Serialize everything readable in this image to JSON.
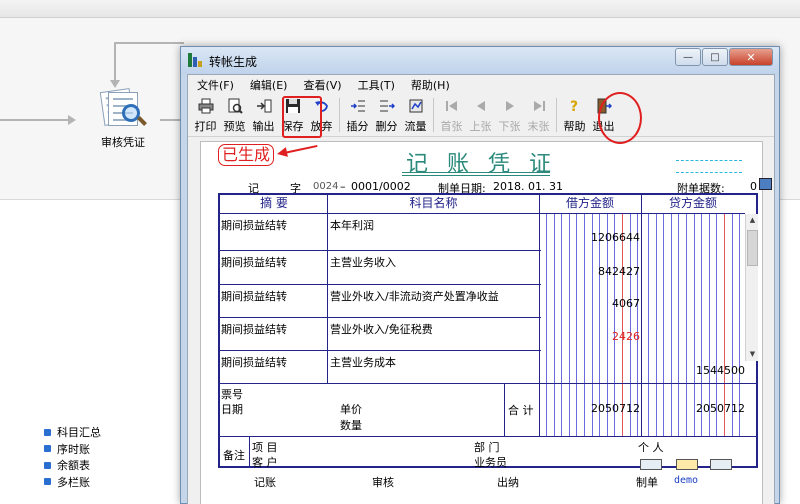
{
  "background": {
    "node_label": "审核凭证",
    "links": [
      "科目汇总",
      "序时账",
      "余额表",
      "多栏账"
    ]
  },
  "window": {
    "title": "转帐生成",
    "close_glyph": "✕",
    "min_glyph": "—",
    "max_glyph": "□"
  },
  "menu": [
    "文件(F)",
    "编辑(E)",
    "查看(V)",
    "工具(T)",
    "帮助(H)"
  ],
  "toolbar": {
    "print": "打印",
    "preview": "预览",
    "export": "输出",
    "save": "保存",
    "discard": "放弃",
    "insert_entry": "插分",
    "delete_entry": "删分",
    "cash_flow": "流量",
    "first": "首张",
    "prev": "上张",
    "next": "下张",
    "last": "末张",
    "help": "帮助",
    "exit": "退出"
  },
  "voucher": {
    "status": "已生成",
    "title": "记 账 凭 证",
    "type_label": "记",
    "number_char": "字",
    "number_code": "0024",
    "number_sep": "–",
    "number": "0001/0002",
    "date_label": "制单日期:",
    "date": "2018. 01. 31",
    "attach_label": "附单据数:",
    "attach_count": "0",
    "headers": {
      "summary": "摘  要",
      "account": "科目名称",
      "debit": "借方金额",
      "credit": "贷方金额"
    },
    "rows": [
      {
        "summary": "期间损益结转",
        "account": "本年利润",
        "debit": "1206644",
        "credit": ""
      },
      {
        "summary": "期间损益结转",
        "account": "主营业务收入",
        "debit": "842427",
        "credit": ""
      },
      {
        "summary": "期间损益结转",
        "account": "营业外收入/非流动资产处置净收益",
        "debit": "4067",
        "credit": ""
      },
      {
        "summary": "期间损益结转",
        "account": "营业外收入/免征税费",
        "debit": "2426",
        "credit": ""
      },
      {
        "summary": "期间损益结转",
        "account": "主营业务成本",
        "debit": "",
        "credit": "1544500"
      }
    ],
    "negative_row_color": "#e02020",
    "info": {
      "ticket_no": "票号",
      "date": "日期",
      "unit_price": "单价",
      "quantity": "数量",
      "total_label": "合 计",
      "debit_total": "2050712",
      "credit_total": "2050712"
    },
    "notes": {
      "label": "备注",
      "project": "项  目",
      "customer": "客  户",
      "department": "部  门",
      "personal": "个  人",
      "salesman": "业务员"
    },
    "signoff": {
      "bookkeeping": "记账",
      "review": "审核",
      "cashier": "出纳",
      "preparer_label": "制单",
      "preparer": "demo"
    }
  },
  "colors": {
    "grid_line": "#23238a",
    "title": "#2b8a7c",
    "highlight": "#e02020",
    "digit_blue": "#3a3ad8",
    "digit_red": "#d82020"
  }
}
